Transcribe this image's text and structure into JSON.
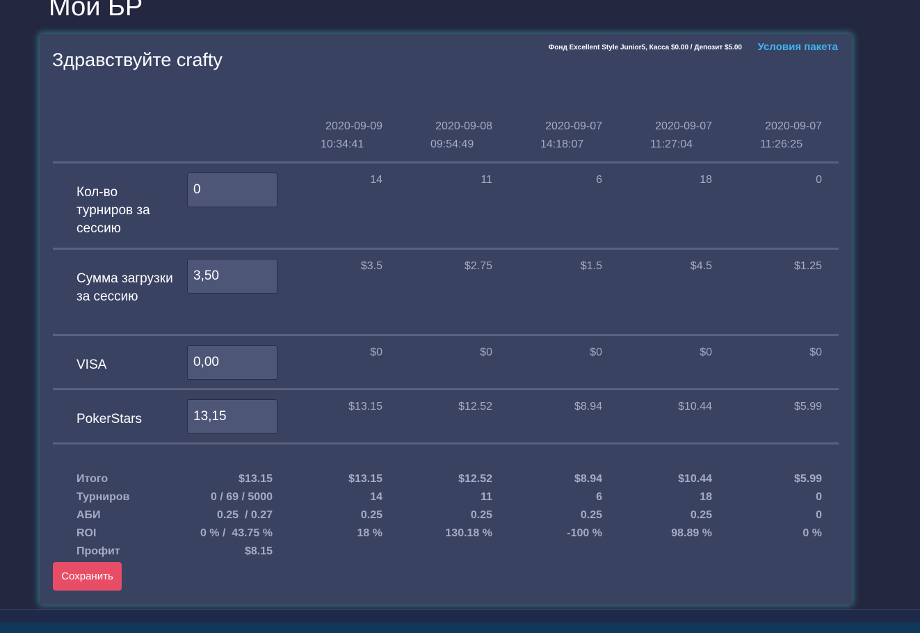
{
  "page": {
    "title": "Мой БР",
    "greeting": "Здравствуйте crafty",
    "fund_info": "Фонд Excellent Style Junior5, Касса $0.00 / Депозит $5.00",
    "package_link": "Условия пакета"
  },
  "columns": [
    {
      "date": "2020-09-09",
      "time": "10:34:41"
    },
    {
      "date": "2020-09-08",
      "time": "09:54:49"
    },
    {
      "date": "2020-09-07",
      "time": "14:18:07"
    },
    {
      "date": "2020-09-07",
      "time": "11:27:04"
    },
    {
      "date": "2020-09-07",
      "time": "11:26:25"
    }
  ],
  "rows": [
    {
      "label": "Кол-во турниров за сессию",
      "input": "0",
      "values": [
        "14",
        "11",
        "6",
        "18",
        "0"
      ]
    },
    {
      "label": "Сумма загрузки за сессию",
      "input": "3,50",
      "values": [
        "$3.5",
        "$2.75",
        "$1.5",
        "$4.5",
        "$1.25"
      ]
    },
    {
      "label": "VISA",
      "input": "0,00",
      "values": [
        "$0",
        "$0",
        "$0",
        "$0",
        "$0"
      ]
    },
    {
      "label": "PokerStars",
      "input": "13,15",
      "values": [
        "$13.15",
        "$12.52",
        "$8.94",
        "$10.44",
        "$5.99"
      ]
    }
  ],
  "summary": [
    {
      "label": "Итого",
      "current": "$13.15",
      "values": [
        "$13.15",
        "$12.52",
        "$8.94",
        "$10.44",
        "$5.99"
      ]
    },
    {
      "label": "Турниров",
      "current": "0 / 69 / 5000",
      "values": [
        "14",
        "11",
        "6",
        "18",
        "0"
      ]
    },
    {
      "label": "АБИ",
      "current": "0.25  / 0.27",
      "values": [
        "0.25",
        "0.25",
        "0.25",
        "0.25",
        "0"
      ]
    },
    {
      "label": "ROI",
      "current": "0 % /  43.75 %",
      "values": [
        "18 %",
        "130.18 %",
        "-100 %",
        "98.89 %",
        "0 %"
      ]
    },
    {
      "label": "Профит",
      "current": "$8.15",
      "values": []
    }
  ],
  "actions": {
    "save_label": "Сохранить"
  },
  "colors": {
    "card_bg": "#3a4262",
    "page_bg": "#23273f",
    "accent_link": "#3fb6f0",
    "save_button": "#e84d67",
    "glow": "#4ab8be"
  }
}
